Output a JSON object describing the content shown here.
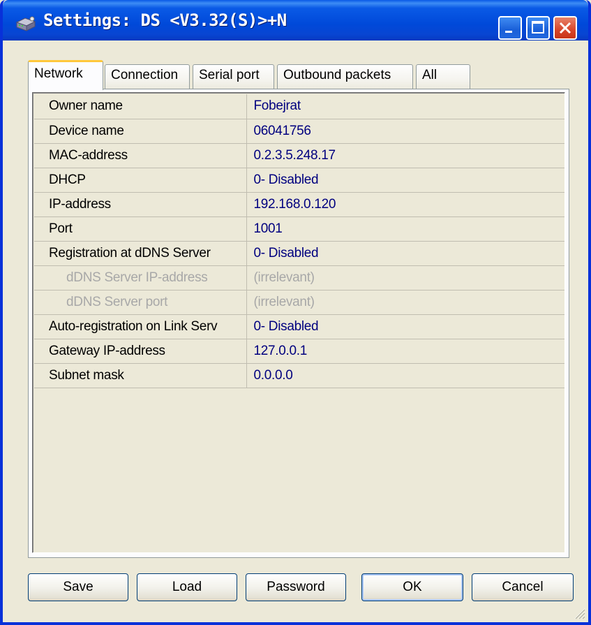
{
  "window": {
    "title": "Settings: DS <V3.32(S)>+N",
    "title_color": "#ffffff",
    "titlebar_color": "#0a5ae6"
  },
  "tabs": [
    {
      "label": "Network",
      "active": true
    },
    {
      "label": "Connection",
      "active": false
    },
    {
      "label": "Serial port",
      "active": false
    },
    {
      "label": "Outbound packets",
      "active": false
    },
    {
      "label": "All",
      "active": false
    }
  ],
  "properties": [
    {
      "name": "Owner name",
      "value": "Fobejrat"
    },
    {
      "name": "Device name",
      "value": "06041756"
    },
    {
      "name": "MAC-address",
      "value": "0.2.3.5.248.17"
    },
    {
      "name": "DHCP",
      "value": "0- Disabled"
    },
    {
      "name": "IP-address",
      "value": "192.168.0.120"
    },
    {
      "name": "Port",
      "value": "1001"
    },
    {
      "name": "Registration at dDNS Server",
      "value": "0- Disabled"
    },
    {
      "name": "dDNS Server IP-address",
      "value": "(irrelevant)"
    },
    {
      "name": "dDNS Server port",
      "value": "(irrelevant)"
    },
    {
      "name": "Auto-registration on Link Serv",
      "value": "0- Disabled"
    },
    {
      "name": "Gateway IP-address",
      "value": "127.0.0.1"
    },
    {
      "name": "Subnet mask",
      "value": "0.0.0.0"
    }
  ],
  "value_color": "#00007f",
  "disabled_color": "#a8a8a8",
  "buttons": {
    "save": "Save",
    "load": "Load",
    "password": "Password",
    "ok": "OK",
    "cancel": "Cancel"
  }
}
